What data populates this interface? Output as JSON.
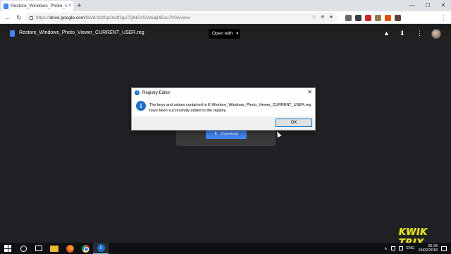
{
  "browser": {
    "tab_title": "Restore_Windows_Photo_Viewe",
    "tab_close": "×",
    "new_tab": "+",
    "window_controls": [
      "—",
      "☐",
      "✕"
    ],
    "url_scheme": "https://",
    "url_domain": "drive.google.com",
    "url_path": "/file/d/19z0pOodf1guTQ6t5YSVe6ajl4Esu7V0o/view",
    "omni_icons": [
      "☆",
      "⊕",
      "★"
    ],
    "nav": {
      "back": "←",
      "forward": "→",
      "reload": "↻"
    },
    "menu": "⋮"
  },
  "drive": {
    "file_name": "Restore_Windows_Photo_Viewer_CURRENT_USER.reg",
    "open_with_label": "Open with",
    "open_with_chevron": "▼",
    "download_label": "Download",
    "download_icon": "⬇",
    "header_icons": {
      "add_to_drive": "▲",
      "download": "⬇",
      "more": "⋮"
    }
  },
  "dialog": {
    "title": "Registry Editor",
    "title_icon": "i",
    "close": "✕",
    "info_icon": "i",
    "message_line1": "The keys and values contained in E:\\Restore_Windows_Photo_Viewer_CURRENT_USER.reg",
    "message_line2": "have been successfully added to the registry.",
    "ok_label": "OK"
  },
  "watermark": "KWIK TRIX",
  "taskbar": {
    "regedit_icon": "i",
    "tray_chevron": "∧",
    "language": "ENG",
    "time": "20:39",
    "date": "15/02/2018"
  },
  "colors": {
    "accent": "#4285f4",
    "dialog_icon": "#1f6fc5",
    "viewer_bg": "#202124",
    "watermark": "#e9e238"
  }
}
